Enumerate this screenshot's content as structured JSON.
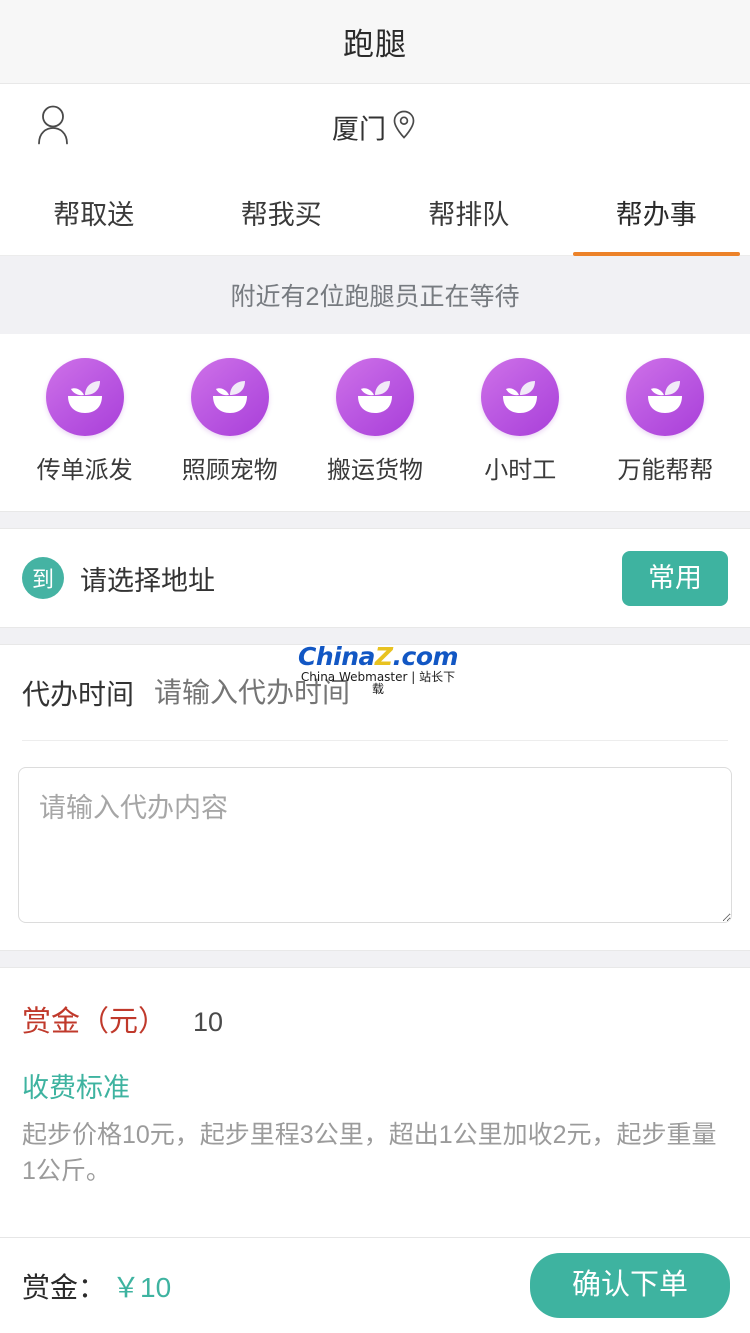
{
  "header": {
    "title": "跑腿"
  },
  "location": {
    "city": "厦门",
    "user_icon": "user-icon",
    "pin_icon": "location-pin-icon"
  },
  "tabs": [
    {
      "label": "帮取送",
      "active": false
    },
    {
      "label": "帮我买",
      "active": false
    },
    {
      "label": "帮排队",
      "active": false
    },
    {
      "label": "帮办事",
      "active": true
    }
  ],
  "notice": {
    "text": "附近有2位跑腿员正在等待",
    "runner_count": "2"
  },
  "services": [
    {
      "label": "传单派发",
      "icon": "salad-bowl-icon"
    },
    {
      "label": "照顾宠物",
      "icon": "salad-bowl-icon"
    },
    {
      "label": "搬运货物",
      "icon": "salad-bowl-icon"
    },
    {
      "label": "小时工",
      "icon": "salad-bowl-icon"
    },
    {
      "label": "万能帮帮",
      "icon": "salad-bowl-icon"
    }
  ],
  "address": {
    "badge": "到",
    "placeholder": "请选择地址",
    "common_button": "常用"
  },
  "time_field": {
    "label": "代办时间",
    "placeholder": "请输入代办时间",
    "value": ""
  },
  "content_field": {
    "placeholder": "请输入代办内容",
    "value": ""
  },
  "reward": {
    "label": "赏金（元）",
    "value": "10",
    "fee_title": "收费标准",
    "fee_desc": "起步价格10元，起步里程3公里，超出1公里加收2元，起步重量1公斤。"
  },
  "bottom": {
    "label": "赏金：",
    "amount": "￥10",
    "submit": "确认下单"
  },
  "watermark": {
    "brand_a": "China",
    "brand_z": "Z",
    "brand_b": ".com",
    "subtitle": "China Webmaster | 站长下载"
  },
  "colors": {
    "accent_teal": "#3eb3a0",
    "tab_active_orange": "#ec8229",
    "reward_red": "#c0392b",
    "service_purple": "#bc5ae2"
  }
}
